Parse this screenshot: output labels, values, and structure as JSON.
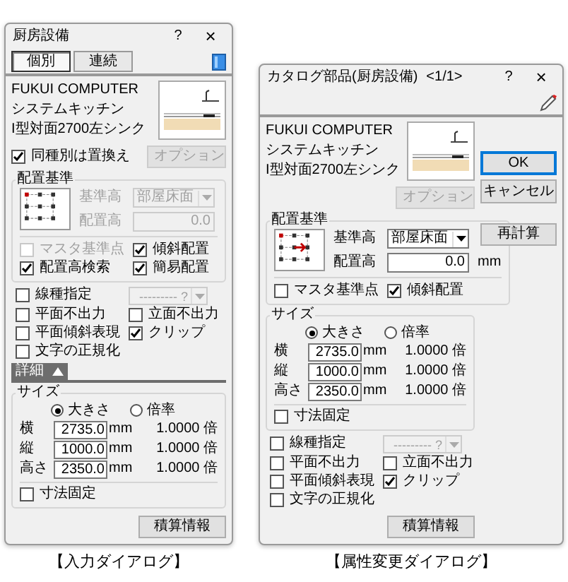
{
  "dialogs": [
    {
      "title": "厨房設備",
      "help": "?",
      "close": "×",
      "tabs": [
        {
          "label": "個別",
          "selected": true
        },
        {
          "label": "連続",
          "selected": false
        }
      ],
      "info": [
        "FUKUI COMPUTER",
        "システムキッチン",
        "I型対面2700左シンク"
      ],
      "replace_check": {
        "label": "同種別は置換え",
        "checked": true
      },
      "option_button": {
        "label": "オプション",
        "disabled": true
      },
      "sections": [
        {
          "kind": "placement",
          "title": "配置基準",
          "reference": {
            "label": "基準高",
            "value": "部屋床面",
            "disabled": true
          },
          "height": {
            "label": "配置高",
            "value": "0.0",
            "disabled": true
          },
          "checks": [
            {
              "label": "マスタ基準点",
              "checked": false,
              "disabled": true
            },
            {
              "label": "傾斜配置",
              "checked": true,
              "disabled": false
            },
            {
              "label": "配置高検索",
              "checked": true,
              "disabled": false
            },
            {
              "label": "簡易配置",
              "checked": true,
              "disabled": false
            }
          ]
        },
        {
          "kind": "options",
          "items": [
            {
              "kind": "checkbox",
              "label": "線種指定",
              "checked": false
            },
            {
              "kind": "dropdown",
              "value": "--------- ?",
              "disabled": true
            },
            {
              "kind": "checkbox",
              "label": "平面不出力",
              "checked": false
            },
            {
              "kind": "checkbox",
              "label": "立面不出力",
              "checked": false
            },
            {
              "kind": "checkbox",
              "label": "平面傾斜表現",
              "checked": false
            },
            {
              "kind": "checkbox",
              "label": "クリップ",
              "checked": true
            },
            {
              "kind": "checkbox",
              "label": "文字の正規化",
              "checked": false
            }
          ]
        },
        {
          "kind": "detail_bar",
          "label": "詳細",
          "expanded": true
        },
        {
          "kind": "size",
          "title": "サイズ",
          "modes": [
            {
              "label": "大きさ",
              "selected": true
            },
            {
              "label": "倍率",
              "selected": false
            }
          ],
          "rows": [
            {
              "label": "横",
              "value": "2735.0",
              "unit": "mm",
              "ratio": "1.0000 倍"
            },
            {
              "label": "縦",
              "value": "1000.0",
              "unit": "mm",
              "ratio": "1.0000 倍"
            },
            {
              "label": "高さ",
              "value": "2350.0",
              "unit": "mm",
              "ratio": "1.0000 倍"
            }
          ],
          "checks": [
            {
              "label": "寸法固定",
              "checked": false
            }
          ]
        }
      ],
      "footer_button": "積算情報",
      "caption": "【入力ダイアログ】"
    },
    {
      "title": "カタログ部品(厨房設備)",
      "page": "<1/1>",
      "help": "?",
      "close": "×",
      "info": [
        "FUKUI COMPUTER",
        "システムキッチン",
        "I型対面2700左シンク"
      ],
      "action_buttons": [
        {
          "label": "OK",
          "default": true
        },
        {
          "label": "キャンセル",
          "default": false
        }
      ],
      "recalc_button": "再計算",
      "option_button": {
        "label": "オプション",
        "disabled": true
      },
      "sections": [
        {
          "kind": "placement",
          "title": "配置基準",
          "reference": {
            "label": "基準高",
            "value": "部屋床面",
            "disabled": false
          },
          "height": {
            "label": "配置高",
            "value": "0.0",
            "unit": "mm",
            "disabled": false
          },
          "checks": [
            {
              "label": "マスタ基準点",
              "checked": false,
              "disabled": false
            },
            {
              "label": "傾斜配置",
              "checked": true,
              "disabled": false
            }
          ]
        },
        {
          "kind": "size",
          "title": "サイズ",
          "modes": [
            {
              "label": "大きさ",
              "selected": true
            },
            {
              "label": "倍率",
              "selected": false
            }
          ],
          "rows": [
            {
              "label": "横",
              "value": "2735.0",
              "unit": "mm",
              "ratio": "1.0000 倍"
            },
            {
              "label": "縦",
              "value": "1000.0",
              "unit": "mm",
              "ratio": "1.0000 倍"
            },
            {
              "label": "高さ",
              "value": "2350.0",
              "unit": "mm",
              "ratio": "1.0000 倍"
            }
          ],
          "checks": [
            {
              "label": "寸法固定",
              "checked": false
            }
          ]
        },
        {
          "kind": "options",
          "items": [
            {
              "kind": "checkbox",
              "label": "線種指定",
              "checked": false
            },
            {
              "kind": "dropdown",
              "value": "--------- ?",
              "disabled": true
            },
            {
              "kind": "checkbox",
              "label": "平面不出力",
              "checked": false
            },
            {
              "kind": "checkbox",
              "label": "立面不出力",
              "checked": false
            },
            {
              "kind": "checkbox",
              "label": "平面傾斜表現",
              "checked": false
            },
            {
              "kind": "checkbox",
              "label": "クリップ",
              "checked": true
            },
            {
              "kind": "checkbox",
              "label": "文字の正規化",
              "checked": false
            }
          ]
        }
      ],
      "footer_button": "積算情報",
      "caption": "【属性変更ダイアログ】"
    }
  ]
}
